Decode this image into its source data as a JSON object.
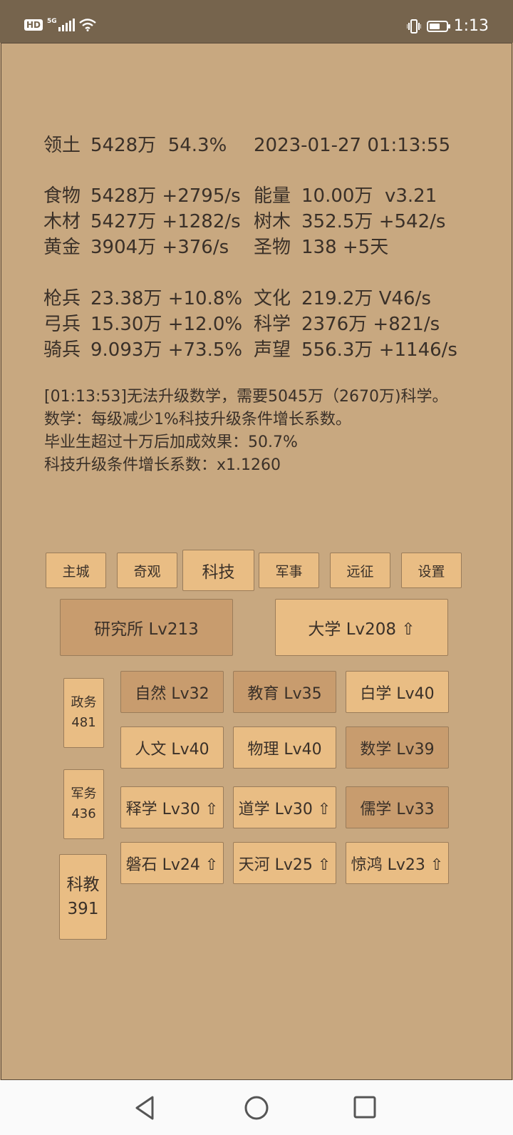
{
  "status_bar": {
    "hd_badge": "HD",
    "network": "5G",
    "time": "1:13",
    "battery_percent": 65,
    "icons": [
      "signal-icon",
      "wifi-icon",
      "vibrate-icon",
      "battery-icon"
    ]
  },
  "resources": {
    "territory": {
      "label": "领土",
      "value": "5428万  54.3%"
    },
    "datetime": "2023-01-27 01:13:55",
    "food": {
      "label": "食物",
      "value": "5428万 +2795/s"
    },
    "energy": {
      "label": "能量",
      "value": "10.00万  v3.21"
    },
    "wood": {
      "label": "木材",
      "value": "5427万 +1282/s"
    },
    "trees": {
      "label": "树木",
      "value": "352.5万 +542/s"
    },
    "gold": {
      "label": "黄金",
      "value": "3904万 +376/s"
    },
    "relics": {
      "label": "圣物",
      "value": "138 +5天"
    },
    "spearmen": {
      "label": "枪兵",
      "value": "23.38万 +10.8%"
    },
    "culture": {
      "label": "文化",
      "value": "219.2万 V46/s"
    },
    "archers": {
      "label": "弓兵",
      "value": "15.30万 +12.0%"
    },
    "science": {
      "label": "科学",
      "value": "2376万 +821/s"
    },
    "cavalry": {
      "label": "骑兵",
      "value": "9.093万 +73.5%"
    },
    "prestige": {
      "label": "声望",
      "value": "556.3万 +1146/s"
    }
  },
  "messages": [
    "[01:13:53]无法升级数学，需要5045万（2670万)科学。",
    "数学：每级减少1%科技升级条件增长系数。",
    "毕业生超过十万后加成效果：50.7%",
    "科技升级条件增长系数：x1.1260"
  ],
  "tabs": [
    "主城",
    "奇观",
    "科技",
    "军事",
    "远征",
    "设置"
  ],
  "active_tab": "科技",
  "buildings": [
    {
      "label": "研究所 Lv213"
    },
    {
      "label": "大学 Lv208 ⇧"
    }
  ],
  "categories": [
    {
      "name": "政务",
      "value": "481"
    },
    {
      "name": "军务",
      "value": "436"
    },
    {
      "name": "科教",
      "value": "391"
    }
  ],
  "techs": [
    {
      "label": "自然 Lv32"
    },
    {
      "label": "教育 Lv35"
    },
    {
      "label": "白学 Lv40"
    },
    {
      "label": "人文 Lv40"
    },
    {
      "label": "物理 Lv40"
    },
    {
      "label": "数学 Lv39"
    },
    {
      "label": "释学 Lv30 ⇧"
    },
    {
      "label": "道学 Lv30 ⇧"
    },
    {
      "label": "儒学 Lv33"
    },
    {
      "label": "磐石 Lv24 ⇧"
    },
    {
      "label": "天河 Lv25 ⇧"
    },
    {
      "label": "惊鸿 Lv23 ⇧"
    }
  ],
  "nav": [
    "back-icon",
    "home-icon",
    "recents-icon"
  ]
}
